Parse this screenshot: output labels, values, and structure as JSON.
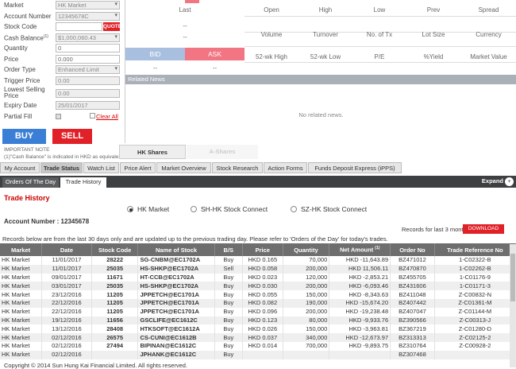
{
  "form": {
    "market": {
      "label": "Market",
      "value": "HK Market"
    },
    "account": {
      "label": "Account Number",
      "value": "12345678C"
    },
    "stock": {
      "label": "Stock Code",
      "value": "",
      "quote": "QUOTE"
    },
    "cash": {
      "label": "Cash Balance",
      "sup": "(1)",
      "value": "$1,000,060.43"
    },
    "quantity": {
      "label": "Quantity",
      "value": "0"
    },
    "price": {
      "label": "Price",
      "value": "0.000"
    },
    "ordertype": {
      "label": "Order Type",
      "value": "Enhanced Limit"
    },
    "trigger": {
      "label": "Trigger Price",
      "value": "0.00"
    },
    "lowest": {
      "label": "Lowest Selling Price",
      "value": "0.00"
    },
    "expiry": {
      "label": "Expiry Date",
      "value": "25/01/2017"
    },
    "partial": {
      "label": "Partial Fill",
      "clear": "Clear All"
    },
    "buy": "BUY",
    "sell": "SELL",
    "important": "IMPORTANT NOTE",
    "note": "(1)\"Cash Balance\" is indicated in HKD as equivalent"
  },
  "quote": {
    "last": "Last",
    "last_val": "--",
    "last_val2": "--",
    "row1": [
      "Open",
      "High",
      "Low",
      "Prev",
      "Spread"
    ],
    "row2": [
      "Volume",
      "Turnover",
      "No. of Tx",
      "Lot Size",
      "Currency"
    ],
    "row3": [
      "52-wk High",
      "52-wk Low",
      "P/E",
      "%Yield",
      "Market Value"
    ],
    "bid": "BID",
    "ask": "ASK",
    "bid_val": "--",
    "ask_val": "--",
    "related": "Related News",
    "nonews": "No related news."
  },
  "hktabs": [
    "HK Shares",
    "A-Shares"
  ],
  "navtabs": [
    "My Account",
    "Trade Status",
    "Watch List",
    "Price Alert",
    "Market Overview",
    "Stock Research",
    "Action Forms",
    "Funds Deposit Express (iPPS)"
  ],
  "subtabs": [
    "Orders Of The Day",
    "Trade History"
  ],
  "expand": "Expand",
  "expand_icon": "+",
  "history": {
    "title": "Trade History",
    "radios": [
      "HK Market",
      "SH-HK Stock Connect",
      "SZ-HK Stock Connect"
    ],
    "account": "Account Number : 12345678",
    "records_label": "Records for last 3 months:",
    "download": "DOWNLOAD",
    "note": "Records below are from the last 30 days only and are updated up to the previous trading day. Please refer to 'Orders of the Day' for today's trades.",
    "columns": [
      "Market",
      "Date",
      "Stock Code",
      "Name of Stock",
      "B/S",
      "Price",
      "Quantity",
      "Net Amount",
      "Order No",
      "Trade Reference No"
    ],
    "net_sup": "(1)",
    "rows": [
      [
        "HK Market",
        "11/01/2017",
        "28222",
        "SG-CNBM@EC1702A",
        "Buy",
        "HKD 0.165",
        "70,000",
        "HKD -11,643.89",
        "BZ471012",
        "1-C02322-B"
      ],
      [
        "HK Market",
        "11/01/2017",
        "25035",
        "HS-SHKP@EC1702A",
        "Sell",
        "HKD 0.058",
        "200,000",
        "HKD 11,506.11",
        "BZ470870",
        "1-C02262-B"
      ],
      [
        "HK Market",
        "09/01/2017",
        "11671",
        "HT-CCB@EC1702A",
        "Buy",
        "HKD 0.023",
        "120,000",
        "HKD -2,853.21",
        "BZ455705",
        "1-C01176-9"
      ],
      [
        "HK Market",
        "03/01/2017",
        "25035",
        "HS-SHKP@EC1702A",
        "Buy",
        "HKD 0.030",
        "200,000",
        "HKD -6,093.46",
        "BZ431606",
        "1-C01171-3"
      ],
      [
        "HK Market",
        "23/12/2016",
        "11205",
        "JPPETCH@EC1701A",
        "Buy",
        "HKD 0.055",
        "150,000",
        "HKD -8,343.63",
        "BZ411048",
        "Z-C00832-N"
      ],
      [
        "HK Market",
        "22/12/2016",
        "11205",
        "JPPETCH@EC1701A",
        "Buy",
        "HKD 0.082",
        "190,000",
        "HKD -15,674.20",
        "BZ407442",
        "Z-C01361-M"
      ],
      [
        "HK Market",
        "22/12/2016",
        "11205",
        "JPPETCH@EC1701A",
        "Buy",
        "HKD 0.096",
        "200,000",
        "HKD -19,238.48",
        "BZ407047",
        "Z-C01144-M"
      ],
      [
        "HK Market",
        "19/12/2016",
        "11656",
        "GSCLIFE@EC1612C",
        "Buy",
        "HKD 0.123",
        "80,000",
        "HKD -9,933.76",
        "BZ390566",
        "Z-C00313-J"
      ],
      [
        "HK Market",
        "13/12/2016",
        "28408",
        "HTKSOFT@EC1612A",
        "Buy",
        "HKD 0.026",
        "150,000",
        "HKD -3,963.81",
        "BZ367219",
        "Z-C01280-D"
      ],
      [
        "HK Market",
        "02/12/2016",
        "26575",
        "CS-CUNI@EC1612B",
        "Buy",
        "HKD 0.037",
        "340,000",
        "HKD -12,673.97",
        "BZ313313",
        "Z-C02125-2"
      ],
      [
        "HK Market",
        "02/12/2016",
        "27494",
        "BIPINAN@EC1612C",
        "Buy",
        "HKD 0.014",
        "700,000",
        "HKD -9,893.75",
        "BZ310764",
        "Z-C00928-2"
      ],
      [
        "HK Market",
        "02/12/2016",
        "",
        "JPHANK@EC1612C",
        "Buy",
        "",
        "",
        "",
        "BZ307468",
        ""
      ]
    ],
    "copyright": "Copyright © 2014 Sun Hung Kai Financial Limited. All rights reserved."
  }
}
